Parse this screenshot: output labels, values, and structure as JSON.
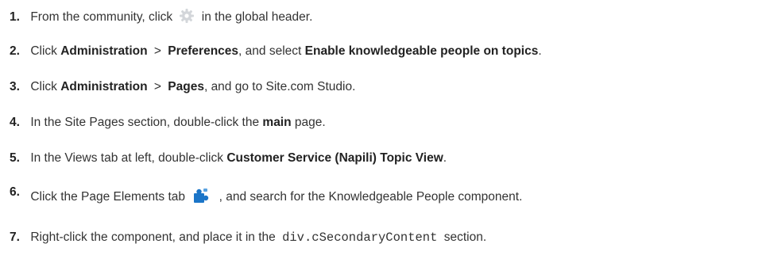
{
  "steps": [
    {
      "number": "1.",
      "before_icon": "From the community, click",
      "icon": "gear-icon",
      "after_icon": "in the global header."
    },
    {
      "number": "2.",
      "text_a": "Click",
      "bold_a": "Administration",
      "sep": ">",
      "bold_b": "Preferences",
      "text_b": ", and select",
      "bold_c": "Enable knowledgeable people on topics",
      "text_c": "."
    },
    {
      "number": "3.",
      "text_a": "Click",
      "bold_a": "Administration",
      "sep": ">",
      "bold_b": "Pages",
      "text_b": ", and go to Site.com Studio."
    },
    {
      "number": "4.",
      "text_a": "In the Site Pages section, double-click the",
      "bold_a": "main",
      "text_b": "page."
    },
    {
      "number": "5.",
      "text_a": "In the Views tab at left, double-click",
      "bold_a": "Customer Service (Napili) Topic View",
      "text_b": "."
    },
    {
      "number": "6.",
      "before_icon": "Click the Page Elements tab",
      "icon": "puzzle-piece-icon",
      "after_icon": ", and search for the Knowledgeable People component."
    },
    {
      "number": "7.",
      "text_a": "Right-click the component, and place it in the",
      "code": "div.cSecondaryContent",
      "text_b": "section."
    }
  ],
  "colors": {
    "text": "#333333",
    "gear_icon": "#d3d6da",
    "puzzle_icon": "#1b75c8"
  }
}
